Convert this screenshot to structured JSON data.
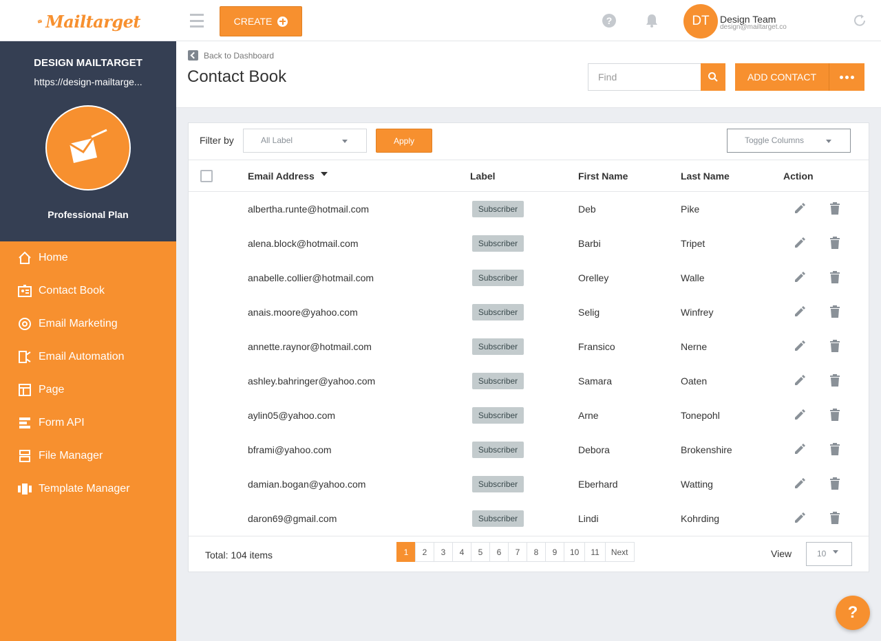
{
  "app": {
    "logo_text": "Mailtarget",
    "create_label": "CREATE",
    "help_glyph": "?",
    "user": {
      "initials": "DT",
      "name": "Design Team",
      "email": "design@mailtarget.co"
    }
  },
  "sidebar": {
    "account_name": "DESIGN MAILTARGET",
    "account_url": "https://design-mailtarge...",
    "plan": "Professional Plan",
    "items": [
      {
        "label": "Home",
        "icon": "home-icon"
      },
      {
        "label": "Contact Book",
        "icon": "contact-card-icon"
      },
      {
        "label": "Email Marketing",
        "icon": "at-sign-icon"
      },
      {
        "label": "Email Automation",
        "icon": "automation-icon"
      },
      {
        "label": "Page",
        "icon": "page-layout-icon"
      },
      {
        "label": "Form API",
        "icon": "form-icon"
      },
      {
        "label": "File Manager",
        "icon": "file-manager-icon"
      },
      {
        "label": "Template Manager",
        "icon": "template-icon"
      }
    ]
  },
  "header": {
    "back_label": "Back to Dashboard",
    "title": "Contact Book",
    "find_placeholder": "Find",
    "add_contact_label": "ADD CONTACT"
  },
  "filter": {
    "label": "Filter by",
    "select_value": "All Label",
    "apply_label": "Apply",
    "toggle_columns": "Toggle Columns"
  },
  "table": {
    "columns": {
      "email": "Email Address",
      "label": "Label",
      "first_name": "First Name",
      "last_name": "Last Name",
      "action": "Action"
    },
    "rows": [
      {
        "email": "albertha.runte@hotmail.com",
        "label": "Subscriber",
        "first": "Deb",
        "last": "Pike"
      },
      {
        "email": "alena.block@hotmail.com",
        "label": "Subscriber",
        "first": "Barbi",
        "last": "Tripet"
      },
      {
        "email": "anabelle.collier@hotmail.com",
        "label": "Subscriber",
        "first": "Orelley",
        "last": "Walle"
      },
      {
        "email": "anais.moore@yahoo.com",
        "label": "Subscriber",
        "first": "Selig",
        "last": "Winfrey"
      },
      {
        "email": "annette.raynor@hotmail.com",
        "label": "Subscriber",
        "first": "Fransico",
        "last": "Nerne"
      },
      {
        "email": "ashley.bahringer@yahoo.com",
        "label": "Subscriber",
        "first": "Samara",
        "last": "Oaten"
      },
      {
        "email": "aylin05@yahoo.com",
        "label": "Subscriber",
        "first": "Arne",
        "last": "Tonepohl"
      },
      {
        "email": "bframi@yahoo.com",
        "label": "Subscriber",
        "first": "Debora",
        "last": "Brokenshire"
      },
      {
        "email": "damian.bogan@yahoo.com",
        "label": "Subscriber",
        "first": "Eberhard",
        "last": "Watting"
      },
      {
        "email": "daron69@gmail.com",
        "label": "Subscriber",
        "first": "Lindi",
        "last": "Kohrding"
      }
    ]
  },
  "footer": {
    "total": "Total: 104 items",
    "pages": [
      "1",
      "2",
      "3",
      "4",
      "5",
      "6",
      "7",
      "8",
      "9",
      "10",
      "11",
      "Next"
    ],
    "active_page": "1",
    "view_label": "View",
    "view_value": "10"
  },
  "colors": {
    "accent": "#f7902f",
    "sidebar_dark": "#353f53",
    "badge": "#c3cbcd"
  }
}
